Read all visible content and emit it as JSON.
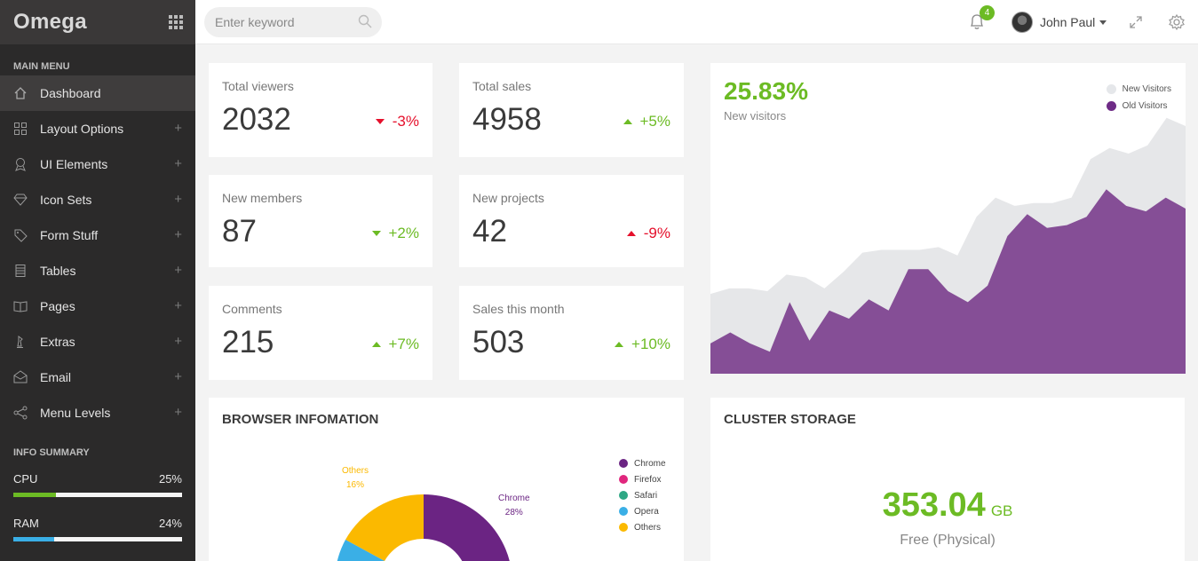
{
  "brand": "Omega",
  "sidebar": {
    "main_menu_title": "MAIN MENU",
    "items": [
      {
        "label": "Dashboard"
      },
      {
        "label": "Layout Options"
      },
      {
        "label": "UI Elements"
      },
      {
        "label": "Icon Sets"
      },
      {
        "label": "Form Stuff"
      },
      {
        "label": "Tables"
      },
      {
        "label": "Pages"
      },
      {
        "label": "Extras"
      },
      {
        "label": "Email"
      },
      {
        "label": "Menu Levels"
      }
    ],
    "plus_glyph": "+",
    "info_title": "INFO SUMMARY",
    "info": [
      {
        "label": "CPU",
        "value": "25%",
        "fraction": 0.25,
        "color": "#6cbb24"
      },
      {
        "label": "RAM",
        "value": "24%",
        "fraction": 0.24,
        "color": "#3aafe6"
      }
    ]
  },
  "topbar": {
    "search_placeholder": "Enter keyword",
    "notification_count": "4",
    "user_name": "John Paul"
  },
  "stats": [
    {
      "label": "Total viewers",
      "value": "2032",
      "delta": "-3%",
      "direction": "down",
      "tone": "neg"
    },
    {
      "label": "Total sales",
      "value": "4958",
      "delta": "+5%",
      "direction": "up",
      "tone": "pos"
    },
    {
      "label": "New members",
      "value": "87",
      "delta": "+2%",
      "direction": "down",
      "tone": "pos"
    },
    {
      "label": "New projects",
      "value": "42",
      "delta": "-9%",
      "direction": "up",
      "tone": "neg"
    },
    {
      "label": "Comments",
      "value": "215",
      "delta": "+7%",
      "direction": "up",
      "tone": "pos"
    },
    {
      "label": "Sales this month",
      "value": "503",
      "delta": "+10%",
      "direction": "up",
      "tone": "pos"
    }
  ],
  "visitors": {
    "value": "25.83%",
    "label": "New visitors",
    "legend": [
      {
        "name": "New Visitors",
        "color": "#e5e7ea"
      },
      {
        "name": "Old Visitors",
        "color": "#6e2b86"
      }
    ]
  },
  "browser": {
    "title": "BROWSER INFOMATION",
    "legend": [
      {
        "name": "Chrome",
        "color": "#6b2483"
      },
      {
        "name": "Firefox",
        "color": "#e0267d"
      },
      {
        "name": "Safari",
        "color": "#2ea784"
      },
      {
        "name": "Opera",
        "color": "#3aafe6"
      },
      {
        "name": "Others",
        "color": "#fbb900"
      }
    ],
    "labels": [
      {
        "name": "Chrome",
        "pct": "28%",
        "color": "#6b2483"
      },
      {
        "name": "Others",
        "pct": "16%",
        "color": "#fbb900"
      }
    ]
  },
  "storage": {
    "title": "CLUSTER STORAGE",
    "value": "353.04",
    "unit": "GB",
    "label": "Free (Physical)"
  },
  "chart_data": {
    "type": "area",
    "series": [
      {
        "name": "New Visitors",
        "values": [
          29,
          31,
          31,
          30,
          36,
          35,
          31,
          37,
          44,
          45,
          45,
          45,
          46,
          43,
          57,
          64,
          61,
          62,
          62,
          64,
          78,
          82,
          80,
          83,
          93,
          90
        ]
      },
      {
        "name": "Old Visitors",
        "values": [
          11,
          15,
          11,
          8,
          26,
          12,
          23,
          20,
          27,
          23,
          38,
          38,
          30,
          26,
          32,
          50,
          58,
          53,
          54,
          57,
          67,
          61,
          59,
          64,
          60
        ]
      }
    ]
  }
}
